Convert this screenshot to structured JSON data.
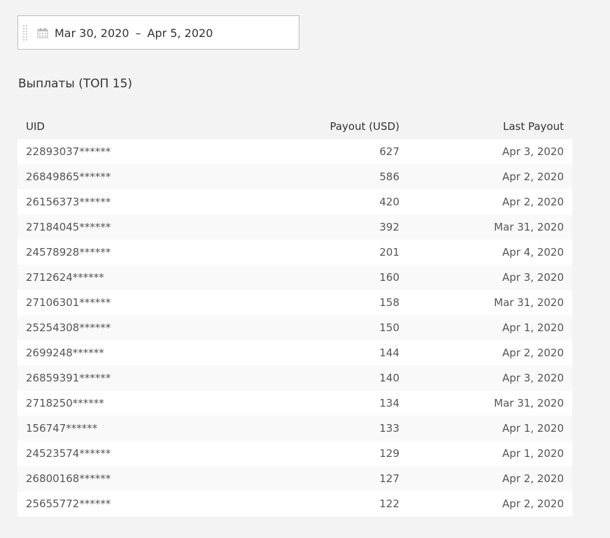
{
  "date_range": {
    "start": "Mar 30, 2020",
    "separator": "–",
    "end": "Apr 5, 2020"
  },
  "section_title": "Выплаты (ТОП 15)",
  "table": {
    "columns": {
      "uid": "UID",
      "payout": "Payout (USD)",
      "last_payout": "Last Payout"
    },
    "rows": [
      {
        "uid": "22893037******",
        "payout": "627",
        "last_payout": "Apr 3, 2020"
      },
      {
        "uid": "26849865******",
        "payout": "586",
        "last_payout": "Apr 2, 2020"
      },
      {
        "uid": "26156373******",
        "payout": "420",
        "last_payout": "Apr 2, 2020"
      },
      {
        "uid": "27184045******",
        "payout": "392",
        "last_payout": "Mar 31, 2020"
      },
      {
        "uid": "24578928******",
        "payout": "201",
        "last_payout": "Apr 4, 2020"
      },
      {
        "uid": "2712624******",
        "payout": "160",
        "last_payout": "Apr 3, 2020"
      },
      {
        "uid": "27106301******",
        "payout": "158",
        "last_payout": "Mar 31, 2020"
      },
      {
        "uid": "25254308******",
        "payout": "150",
        "last_payout": "Apr 1, 2020"
      },
      {
        "uid": "2699248******",
        "payout": "144",
        "last_payout": "Apr 2, 2020"
      },
      {
        "uid": "26859391******",
        "payout": "140",
        "last_payout": "Apr 3, 2020"
      },
      {
        "uid": "2718250******",
        "payout": "134",
        "last_payout": "Mar 31, 2020"
      },
      {
        "uid": "156747******",
        "payout": "133",
        "last_payout": "Apr 1, 2020"
      },
      {
        "uid": "24523574******",
        "payout": "129",
        "last_payout": "Apr 1, 2020"
      },
      {
        "uid": "26800168******",
        "payout": "127",
        "last_payout": "Apr 2, 2020"
      },
      {
        "uid": "25655772******",
        "payout": "122",
        "last_payout": "Apr 2, 2020"
      }
    ]
  },
  "icons": {
    "drag": "drag-handle-icon",
    "calendar": "calendar-icon"
  },
  "colors": {
    "page_background": "#f3f3f3",
    "row_odd": "#ffffff",
    "row_even": "#f9f9f9",
    "border": "#bdbdbd",
    "text": "#333333"
  }
}
